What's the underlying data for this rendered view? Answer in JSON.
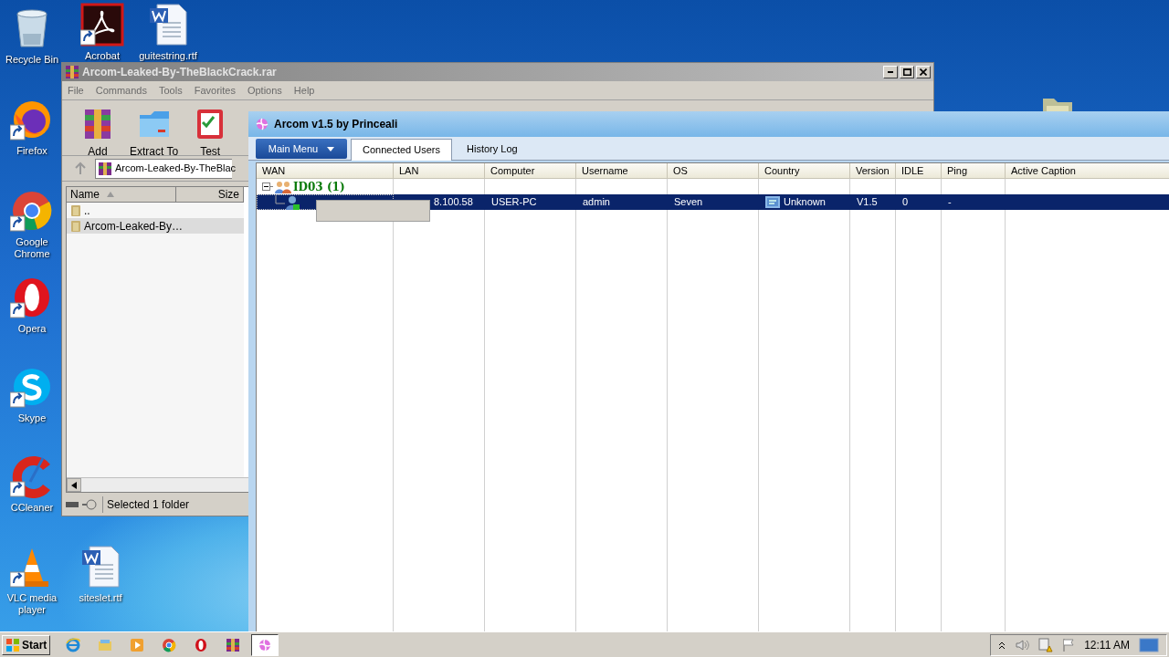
{
  "desktop": {
    "icons": [
      {
        "label": "Recycle Bin",
        "kind": "recycle",
        "shortcut": false
      },
      {
        "label": "Acrobat",
        "kind": "acrobat",
        "shortcut": true
      },
      {
        "label": "guitestring.rtf",
        "kind": "word",
        "shortcut": false
      },
      {
        "label": "Firefox",
        "kind": "firefox",
        "shortcut": true
      },
      {
        "label": "Google Chrome",
        "kind": "chrome",
        "shortcut": true
      },
      {
        "label": "Opera",
        "kind": "opera",
        "shortcut": true
      },
      {
        "label": "Skype",
        "kind": "skype",
        "shortcut": true
      },
      {
        "label": "CCleaner",
        "kind": "ccleaner",
        "shortcut": true
      },
      {
        "label": "VLC media player",
        "kind": "vlc",
        "shortcut": true
      },
      {
        "label": "siteslet.rtf",
        "kind": "word",
        "shortcut": false
      }
    ]
  },
  "winrar": {
    "title": "Arcom-Leaked-By-TheBlackCrack.rar",
    "menu": [
      "File",
      "Commands",
      "Tools",
      "Favorites",
      "Options",
      "Help"
    ],
    "toolbar": [
      {
        "label": "Add",
        "kind": "add"
      },
      {
        "label": "Extract To",
        "kind": "extract"
      },
      {
        "label": "Test",
        "kind": "test"
      }
    ],
    "address": "Arcom-Leaked-By-TheBlac",
    "columns": [
      "Name",
      "Size"
    ],
    "rows": [
      {
        "name": "..",
        "selected": false
      },
      {
        "name": "Arcom-Leaked-By…",
        "selected": true
      }
    ],
    "status": "Selected 1 folder"
  },
  "arcom": {
    "title": "Arcom v1.5 by Princeali",
    "main_menu": "Main Menu",
    "tabs": [
      {
        "label": "Connected Users",
        "selected": true
      },
      {
        "label": "History Log",
        "selected": false
      }
    ],
    "columns": [
      "WAN",
      "LAN",
      "Computer",
      "Username",
      "OS",
      "Country",
      "Version",
      "IDLE",
      "Ping",
      "Active Caption"
    ],
    "groups": [
      {
        "name": "ID03 (1)",
        "expanded": true,
        "children": [
          {
            "selected": true,
            "values": [
              "8.100.58",
              "USER-PC",
              "admin",
              "Seven",
              "Unknown",
              "V1.5",
              "0",
              "-"
            ]
          }
        ]
      }
    ]
  },
  "taskbar": {
    "start": "Start",
    "buttons": [
      {
        "kind": "ie",
        "selected": false
      },
      {
        "kind": "explorer",
        "selected": false
      },
      {
        "kind": "player",
        "selected": false
      },
      {
        "kind": "chrome",
        "selected": false
      },
      {
        "kind": "opera",
        "selected": false
      },
      {
        "kind": "winrar",
        "selected": false
      },
      {
        "kind": "arcom",
        "selected": true
      }
    ],
    "clock": "12:11 AM"
  }
}
